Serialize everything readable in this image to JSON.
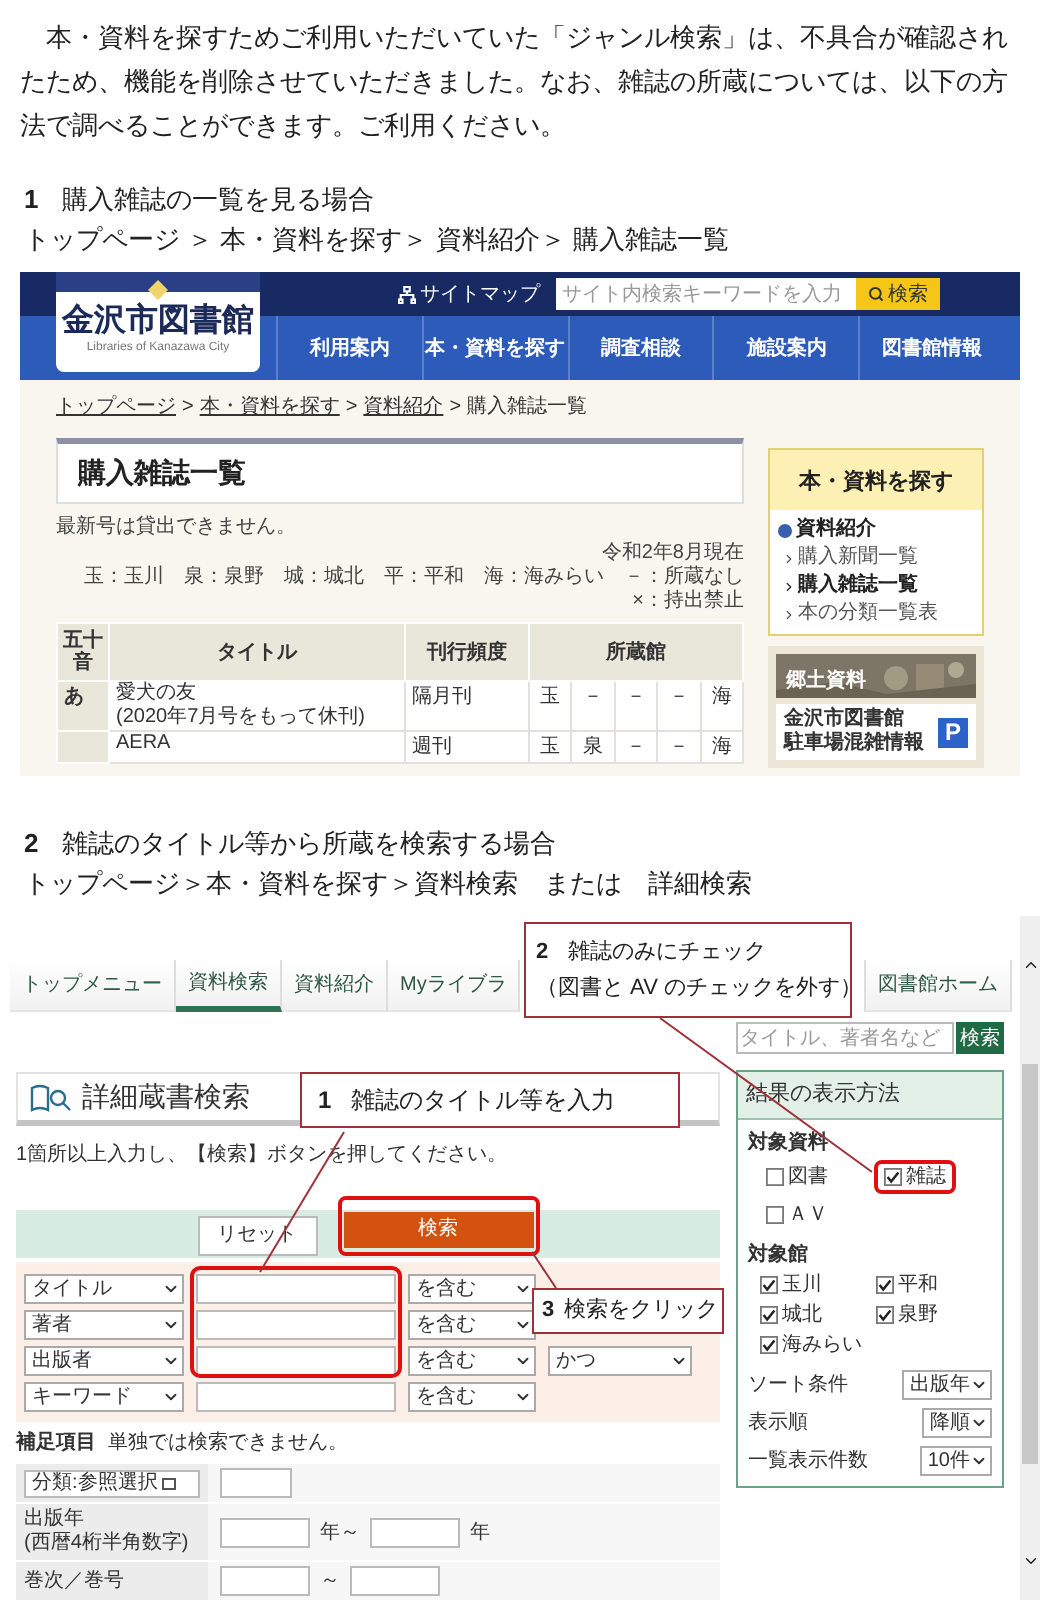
{
  "intro": "　本・資料を探すためご利用いただいていた「ジャンル検索」は、不具合が確認されたため、機能を削除させていただきました。なお、雑誌の所蔵については、以下の方法で調べることができます。ご利用ください。",
  "section_1": {
    "number": "1",
    "title": "購入雑誌の一覧を見る場合",
    "path": "トップページ ＞ 本・資料を探す＞ 資料紹介＞ 購入雑誌一覧",
    "screenshot": {
      "header": {
        "sitemap": "サイトマップ",
        "search_placeholder": "サイト内検索キーワードを入力",
        "search_button": "検索"
      },
      "logo": {
        "name": "金沢市図書館",
        "subtitle": "Libraries of Kanazawa City"
      },
      "nav": [
        "利用案内",
        "本・資料を探す",
        "調査相談",
        "施設案内",
        "図書館情報"
      ],
      "breadcrumb": {
        "separator": ">",
        "items": [
          {
            "label": "トップページ",
            "link": true
          },
          {
            "label": "本・資料を探す",
            "link": true
          },
          {
            "label": "資料紹介",
            "link": true
          },
          {
            "label": "購入雑誌一覧",
            "link": false
          }
        ]
      },
      "page_title": "購入雑誌一覧",
      "note": "最新号は貸出できません。",
      "as_of": "令和2年8月現在",
      "legend": "玉：玉川　泉：泉野　城：城北　平：平和　海：海みらい　－：所蔵なし　×：持出禁止",
      "table": {
        "columns": [
          "五十音",
          "タイトル",
          "刊行頻度",
          "所蔵館"
        ],
        "rows": [
          {
            "index": "あ",
            "title": "愛犬の友",
            "title_note": "(2020年7月号をもって休刊)",
            "frequency": "隔月刊",
            "holdings": [
              "玉",
              "－",
              "－",
              "－",
              "海"
            ]
          },
          {
            "title": "AERA",
            "frequency": "週刊",
            "holdings": [
              "玉",
              "泉",
              "－",
              "－",
              "海"
            ]
          }
        ]
      },
      "sidebar": {
        "heading": "本・資料を探す",
        "section": "資料紹介",
        "links": [
          {
            "label": "購入新聞一覧",
            "selected": false
          },
          {
            "label": "購入雑誌一覧",
            "selected": true
          },
          {
            "label": "本の分類一覧表",
            "selected": false
          }
        ],
        "banner": "郷土資料",
        "parking": [
          "金沢市図書館",
          "駐車場混雑情報"
        ],
        "parking_icon": "P"
      }
    }
  },
  "section_2": {
    "number": "2",
    "title": "雑誌のタイトル等から所蔵を検索する場合",
    "path": "トップページ＞本・資料を探す＞資料検索　または　詳細検索",
    "screenshot": {
      "tabs": [
        {
          "label": "トップメニュー",
          "selected": false
        },
        {
          "label": "資料検索",
          "selected": true
        },
        {
          "label": "資料紹介",
          "selected": false
        },
        {
          "label": "Myライブラ",
          "selected": false
        },
        {
          "label": "図書館ホーム",
          "selected": false
        }
      ],
      "quick_search": {
        "placeholder": "タイトル、著者名など",
        "button": "検索"
      },
      "title": "詳細蔵書検索",
      "instruction": "1箇所以上入力し、【検索】ボタンを押してください。",
      "buttons": [
        {
          "label": "リセット",
          "kind": "plain",
          "highlighted": false
        },
        {
          "label": "検索",
          "kind": "primary",
          "highlighted": true
        }
      ],
      "conditions": [
        {
          "field": "タイトル",
          "match": "を含む",
          "highlighted": true
        },
        {
          "field": "著者",
          "match": "を含む",
          "highlighted": true
        },
        {
          "field": "出版者",
          "match": "を含む",
          "connector": "かつ",
          "highlighted": true
        },
        {
          "field": "キーワード",
          "match": "を含む",
          "highlighted": false
        }
      ],
      "supplement": {
        "label": "補足項目",
        "note": "単独では検索できません。",
        "rows": [
          {
            "kind": "classification",
            "label": "分類:参照選択"
          },
          {
            "kind": "year",
            "label": "出版年",
            "hint": "(西暦4桁半角数字)",
            "from_suffix": "年～",
            "to_suffix": "年"
          },
          {
            "kind": "volume",
            "label": "巻次／巻号",
            "separator": "～"
          }
        ]
      },
      "options": {
        "title": "結果の表示方法",
        "material_label": "対象資料",
        "materials": [
          {
            "label": "図書",
            "checked": false,
            "highlighted": false
          },
          {
            "label": "雑誌",
            "checked": true,
            "highlighted": true
          },
          {
            "label": "ＡＶ",
            "checked": false,
            "highlighted": false
          }
        ],
        "branch_label": "対象館",
        "branches": [
          {
            "label": "玉川",
            "checked": true
          },
          {
            "label": "平和",
            "checked": true
          },
          {
            "label": "城北",
            "checked": true
          },
          {
            "label": "泉野",
            "checked": true
          },
          {
            "label": "海みらい",
            "checked": true
          }
        ],
        "selects": [
          {
            "label": "ソート条件",
            "value": "出版年"
          },
          {
            "label": "表示順",
            "value": "降順"
          },
          {
            "label": "一覧表示件数",
            "value": "10件"
          }
        ]
      },
      "callouts": [
        {
          "number": "1",
          "text": "雑誌のタイトル等を入力"
        },
        {
          "number": "2",
          "text": "雑誌のみにチェック",
          "note": "（図書と AV のチェックを外す）"
        },
        {
          "number": "3",
          "text": "検索をクリック"
        }
      ]
    }
  }
}
